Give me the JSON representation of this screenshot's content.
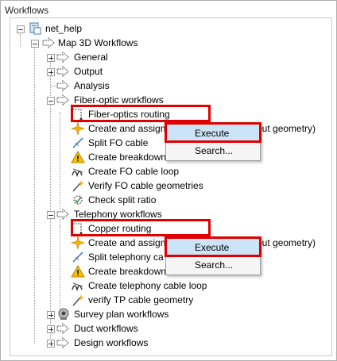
{
  "panel": {
    "title": "Workflows"
  },
  "tree": {
    "root": "net_help",
    "map3d": "Map 3D Workflows",
    "general": "General",
    "output": "Output",
    "analysis": "Analysis",
    "fiber_group": "Fiber-optic workflows",
    "fiber_items": [
      "Fiber-optics routing",
      "Create and assign",
      "Split FO cable",
      "Create breakdown",
      "Create FO cable loop",
      "Verify FO cable geometries",
      "Check split ratio"
    ],
    "fiber_trunc_suffix": "out geometry)",
    "telephony_group": "Telephony workflows",
    "telephony_items": [
      "Copper routing",
      "Create and assign",
      "Split telephony ca",
      "Create breakdown",
      "Create telephony cable loop",
      "verify TP cable geometry"
    ],
    "telephony_trunc_suffix": "out geometry)",
    "survey": "Survey plan workflows",
    "duct": "Duct workflows",
    "design": "Design workflows"
  },
  "context_menu_1": {
    "items": [
      "Execute",
      "Search..."
    ]
  },
  "context_menu_2": {
    "items": [
      "Execute",
      "Search..."
    ]
  },
  "colors": {
    "highlight": "#e00000",
    "menu_active": "#cce4f7"
  }
}
